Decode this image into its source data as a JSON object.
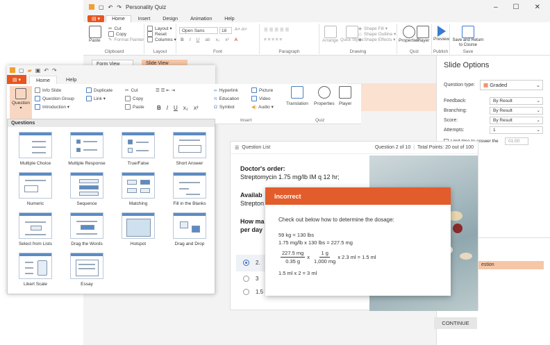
{
  "back_window": {
    "title": "Personality Quiz",
    "tabs": [
      "Home",
      "Insert",
      "Design",
      "Animation",
      "Help"
    ],
    "file_label": "▤ ▾",
    "clipboard": {
      "paste": "Paste",
      "cut": "Cut",
      "copy": "Copy",
      "format_painter": "Format Painter",
      "label": "Clipboard"
    },
    "layout": {
      "layout": "Layout ▾",
      "reset": "Reset",
      "columns": "Columns ▾",
      "label": "Layout"
    },
    "font": {
      "family": "Open Sans",
      "size": "18",
      "label": "Font"
    },
    "paragraph": {
      "label": "Paragraph"
    },
    "drawing": {
      "arrange": "Arrange",
      "quick_styles": "Quick Styles",
      "shape_fill": "Shape Fill ▾",
      "shape_outline": "Shape Outline ▾",
      "shape_effects": "Shape Effects ▾",
      "label": "Drawing"
    },
    "quiz": {
      "properties": "Properties",
      "player": "Player",
      "label": "Quiz"
    },
    "publish": {
      "preview": "Preview",
      "label": "Publish"
    },
    "save": {
      "save_return": "Save and Return to Course",
      "label": "Save"
    },
    "views": {
      "form_view": "Form View",
      "slide_view": "Slide View"
    }
  },
  "slide_options": {
    "title": "Slide Options",
    "question_type_label": "Question type:",
    "question_type_value": "Graded",
    "rows": [
      {
        "label": "Feedback:",
        "value": "By Result"
      },
      {
        "label": "Branching:",
        "value": "By Result"
      },
      {
        "label": "Score:",
        "value": "By Result"
      },
      {
        "label": "Attempts:",
        "value": "1"
      }
    ],
    "limit_time": "Limit time to answer the",
    "time_value": "01:00",
    "list_item": "estion"
  },
  "front_window": {
    "tabs": [
      "Home",
      "Help"
    ],
    "question": "Question",
    "info_slide": "Info Slide",
    "question_group": "Question Group",
    "introduction": "Introduction ▾",
    "duplicate": "Duplicate",
    "link": "Link ▾",
    "cut": "Cut",
    "copy": "Copy",
    "paste": "Paste",
    "hyperlink": "Hyperlink",
    "education": "Education",
    "symbol": "Symbol",
    "picture": "Picture",
    "video": "Video",
    "audio": "Audio ▾",
    "insert_label": "Insert",
    "translation": "Translation",
    "properties": "Properties",
    "player": "Player",
    "quiz_label": "Quiz",
    "format": {
      "bold": "B",
      "italic": "I",
      "underline": "U",
      "sub": "x₂",
      "sup": "x²"
    }
  },
  "questions_popup": {
    "header": "Questions",
    "items": [
      "Multiple Choice",
      "Multiple Response",
      "True/False",
      "Short Answer",
      "Numeric",
      "Sequence",
      "Matching",
      "Fill in the Blanks",
      "Select from Lists",
      "Drag the Words",
      "Hotspot",
      "Drag and Drop",
      "Likert Scale",
      "Essay"
    ]
  },
  "player": {
    "question_list": "Question List",
    "progress": "Question 2 of 10",
    "points": "Total Points: 20 out of 100",
    "order_title": "Doctor's order:",
    "order_text": "Streptomycin 1.75 mg/lb IM q 12 hr;",
    "available_partial": "Availab",
    "available_text_partial": "Strepton",
    "question_partial_1": "How ma",
    "question_partial_2": "per day",
    "options": [
      "2.",
      "3",
      "1.5"
    ],
    "continue": "CONTINUE"
  },
  "feedback": {
    "title": "Incorrect",
    "intro": "Check out below how to determine the dosage:",
    "line1": "59 kg = 130 lbs",
    "line2": "1.75 mg/lb x 130 lbs = 227.5 mg",
    "frac1_num": "227.5 mg",
    "frac1_den": "0.35 g",
    "times": "x",
    "frac2_num": "1 g",
    "frac2_den": "1,000 mg",
    "tail": "x  2.3 ml = 1.5 ml",
    "line4": "1.5 ml x 2 = 3 ml"
  },
  "colors": {
    "accent": "#e8551e",
    "feedback_header": "#e35c2b",
    "selection": "#3a6fc2"
  }
}
